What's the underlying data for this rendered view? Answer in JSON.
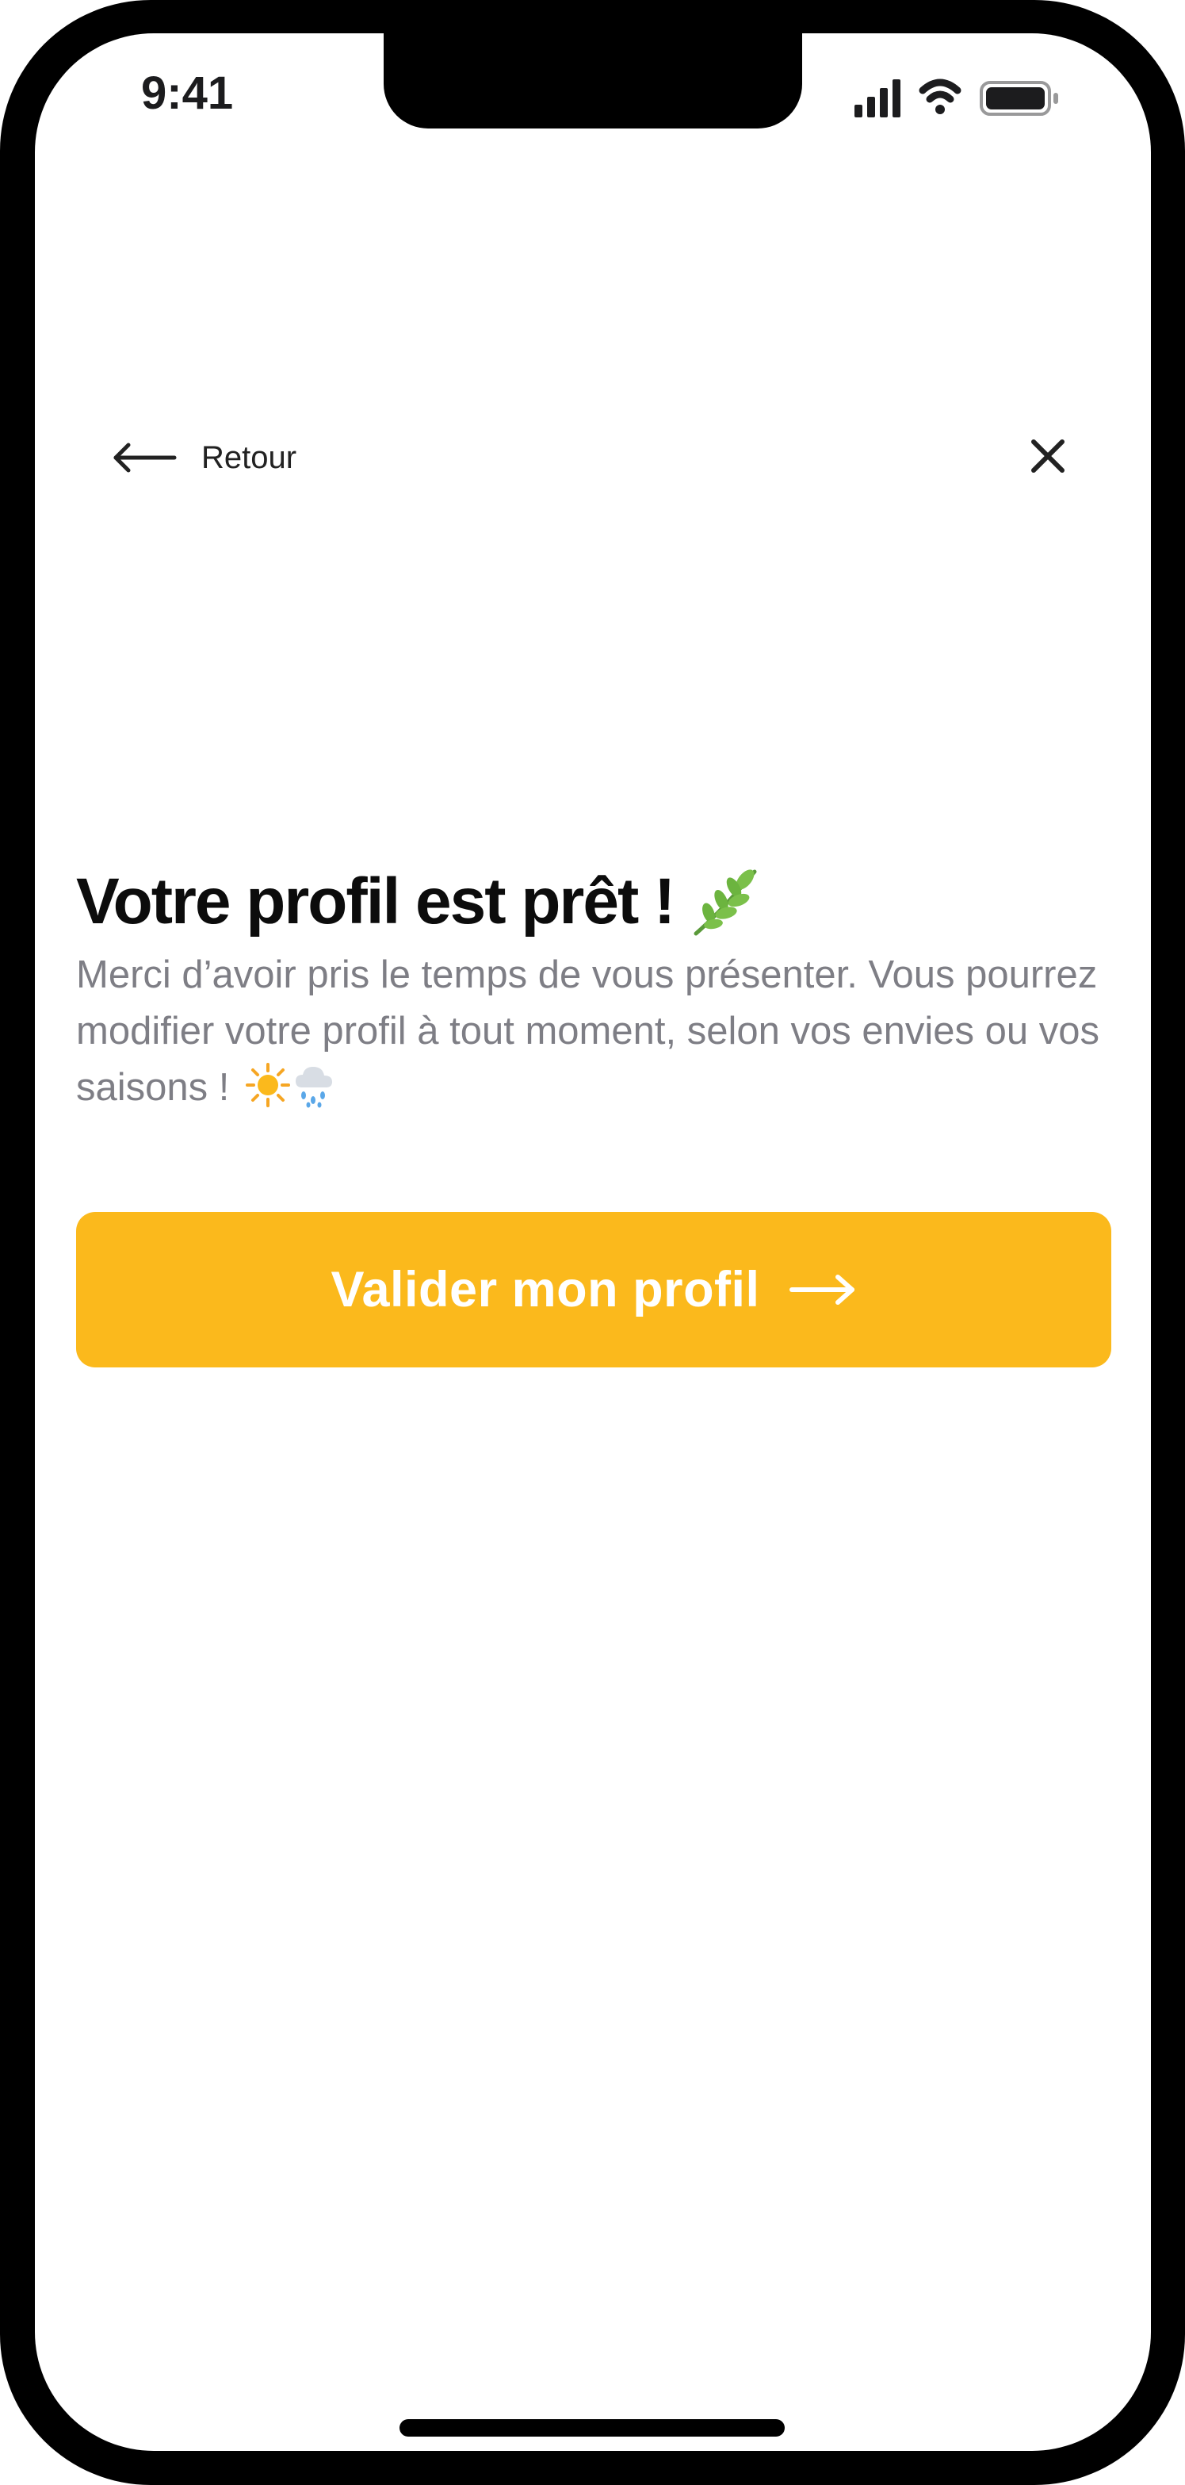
{
  "status_bar": {
    "time": "9:41",
    "signal_icon": "cellular-signal-icon",
    "wifi_icon": "wifi-icon",
    "battery_icon": "battery-icon"
  },
  "nav": {
    "back_icon": "arrow-left-icon",
    "back_label": "Retour",
    "close_icon": "close-icon"
  },
  "content": {
    "title": "Votre profil est prêt !",
    "title_icon": "herb-leaf-icon",
    "subtitle": "Merci d’avoir pris le temps de vous présenter. Vous pourrez modifier votre profil à tout moment, selon vos envies ou vos saisons !",
    "subtitle_icons": [
      "sun-icon",
      "rain-cloud-icon"
    ]
  },
  "cta": {
    "label": "Valider mon profil",
    "arrow_icon": "arrow-right-icon",
    "color": "#FBB91C"
  },
  "colors": {
    "title_text": "#0C0C0C",
    "subtitle_text": "#7E7E85",
    "background": "#FFFFFF",
    "frame": "#000000"
  }
}
